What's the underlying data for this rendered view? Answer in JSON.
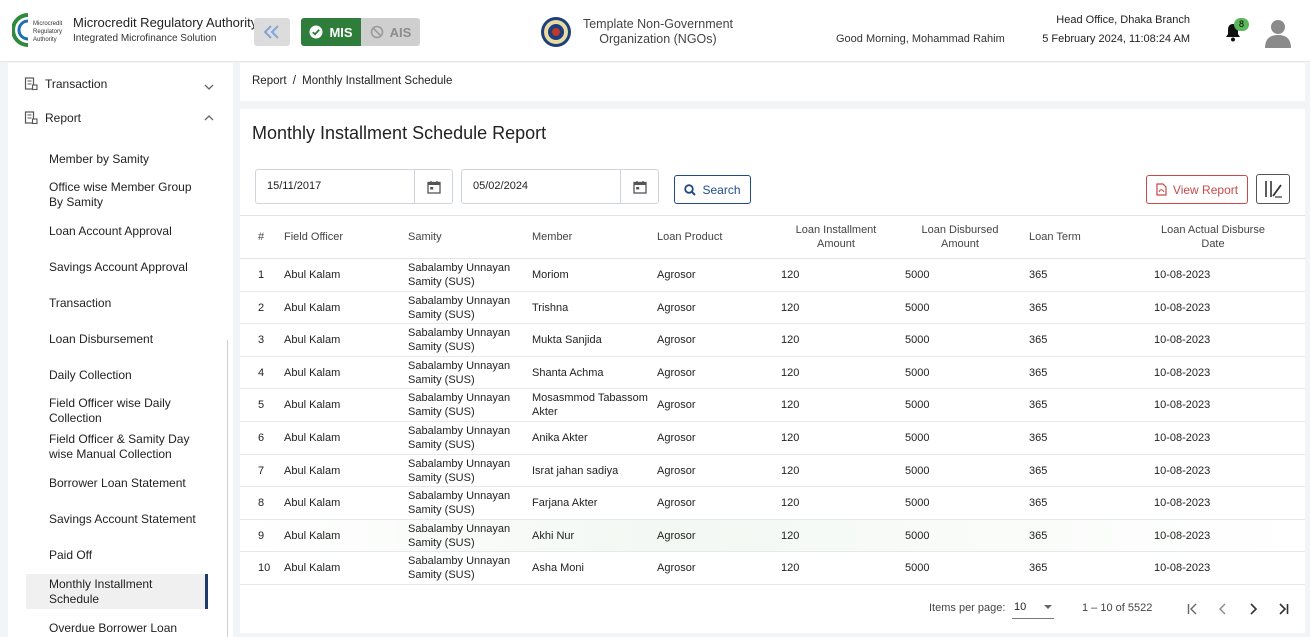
{
  "header": {
    "brand_title": "Microcredit Regulatory Authority",
    "brand_subtitle": "Integrated Microfinance Solution",
    "logo_text_lines": [
      "Microcredit",
      "Regulatory",
      "Authority"
    ],
    "mode_mis": "MIS",
    "mode_ais": "AIS",
    "org_name": "Template Non-Government Organization (NGOs)",
    "greeting": "Good Morning, Mohammad Rahim",
    "branch": "Head Office, Dhaka Branch",
    "datetime": "5 February 2024, 11:08:24 AM",
    "notification_count": "8",
    "accent_green": "#2f7d3b"
  },
  "sidebar": {
    "top_items": [
      {
        "label": "Transaction",
        "icon": "document-list-icon",
        "expanded": false
      },
      {
        "label": "Report",
        "icon": "document-list-icon",
        "expanded": true
      }
    ],
    "report_items": [
      {
        "label": "Member by Samity"
      },
      {
        "label": "Office wise Member Group By Samity"
      },
      {
        "label": "Loan Account Approval"
      },
      {
        "label": "Savings Account Approval"
      },
      {
        "label": "Transaction"
      },
      {
        "label": "Loan Disbursement"
      },
      {
        "label": "Daily Collection"
      },
      {
        "label": "Field Officer wise Daily Collection"
      },
      {
        "label": "Field Officer & Samity Day wise Manual Collection"
      },
      {
        "label": "Borrower Loan Statement"
      },
      {
        "label": "Savings Account Statement"
      },
      {
        "label": "Paid Off"
      },
      {
        "label": "Monthly Installment Schedule",
        "active": true
      },
      {
        "label": "Overdue Borrower Loan"
      }
    ]
  },
  "breadcrumb": {
    "parent": "Report",
    "separator": "/",
    "current": "Monthly Installment Schedule"
  },
  "page": {
    "title": "Monthly Installment Schedule Report",
    "from_date": "15/11/2017",
    "to_date": "05/02/2024",
    "search_label": "Search",
    "view_report_label": "View Report"
  },
  "table": {
    "columns": [
      "#",
      "Field Officer",
      "Samity",
      "Member",
      "Loan Product",
      "Loan Installment Amount",
      "Loan Disbursed Amount",
      "Loan Term",
      "Loan Actual Disburse Date"
    ],
    "rows": [
      [
        "1",
        "Abul Kalam",
        "Sabalamby Unnayan Samity (SUS)",
        "Moriom",
        "Agrosor",
        "120",
        "5000",
        "365",
        "10-08-2023"
      ],
      [
        "2",
        "Abul Kalam",
        "Sabalamby Unnayan Samity (SUS)",
        "Trishna",
        "Agrosor",
        "120",
        "5000",
        "365",
        "10-08-2023"
      ],
      [
        "3",
        "Abul Kalam",
        "Sabalamby Unnayan Samity (SUS)",
        "Mukta Sanjida",
        "Agrosor",
        "120",
        "5000",
        "365",
        "10-08-2023"
      ],
      [
        "4",
        "Abul Kalam",
        "Sabalamby Unnayan Samity (SUS)",
        "Shanta Achma",
        "Agrosor",
        "120",
        "5000",
        "365",
        "10-08-2023"
      ],
      [
        "5",
        "Abul Kalam",
        "Sabalamby Unnayan Samity (SUS)",
        "Mosasmmod Tabassom Akter",
        "Agrosor",
        "120",
        "5000",
        "365",
        "10-08-2023"
      ],
      [
        "6",
        "Abul Kalam",
        "Sabalamby Unnayan Samity (SUS)",
        "Anika Akter",
        "Agrosor",
        "120",
        "5000",
        "365",
        "10-08-2023"
      ],
      [
        "7",
        "Abul Kalam",
        "Sabalamby Unnayan Samity (SUS)",
        "Israt jahan sadiya",
        "Agrosor",
        "120",
        "5000",
        "365",
        "10-08-2023"
      ],
      [
        "8",
        "Abul Kalam",
        "Sabalamby Unnayan Samity (SUS)",
        "Farjana Akter",
        "Agrosor",
        "120",
        "5000",
        "365",
        "10-08-2023"
      ],
      [
        "9",
        "Abul Kalam",
        "Sabalamby Unnayan Samity (SUS)",
        "Akhi Nur",
        "Agrosor",
        "120",
        "5000",
        "365",
        "10-08-2023"
      ],
      [
        "10",
        "Abul Kalam",
        "Sabalamby Unnayan Samity (SUS)",
        "Asha Moni",
        "Agrosor",
        "120",
        "5000",
        "365",
        "10-08-2023"
      ]
    ],
    "highlighted_row": 8
  },
  "pagination": {
    "items_per_page_label": "Items per page:",
    "items_per_page": "10",
    "range": "1 – 10 of 5522"
  }
}
